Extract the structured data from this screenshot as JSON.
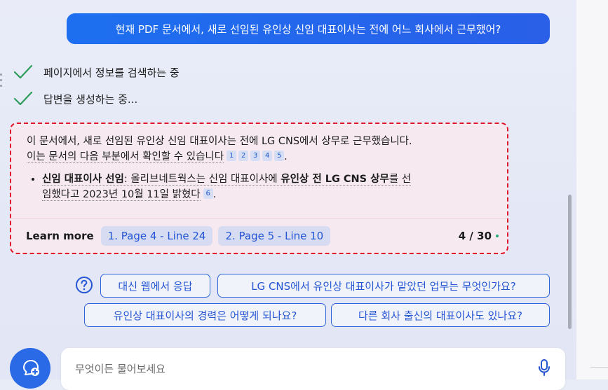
{
  "user_message": "현재 PDF 문서에서, 새로 선임된 유인상 신임 대표이사는 전에 어느 회사에서 근무했어?",
  "progress": [
    {
      "icon": "checkmark-icon",
      "label": "페이지에서 정보를 검색하는 중"
    },
    {
      "icon": "checkmark-icon",
      "label": "답변을 생성하는 중..."
    }
  ],
  "answer": {
    "line1": "이 문서에서, 새로 선임된 유인상 신임 대표이사는 전에 LG CNS에서 상무로 근무했습니다.",
    "line2": "이는 문서의 다음 부분에서 확인할 수 있습니다",
    "line2_citations": [
      "1",
      "2",
      "3",
      "4",
      "5"
    ],
    "bullet": {
      "bold1": "신임 대표이사 선임",
      "text1": ": 올리브네트웍스는 신임 대표이사에 ",
      "bold2": "유인상 전 LG CNS 상무",
      "text2": "를 선",
      "line2": "임했다고 2023년 10월 11일 밝혔다",
      "citation": "6"
    }
  },
  "learn_more": {
    "label": "Learn more",
    "sources": [
      "1. Page 4 - Line 24",
      "2. Page 5 - Line 10"
    ],
    "count": "4 / 30"
  },
  "suggestions": [
    "대신 웹에서 응답",
    "LG CNS에서 유인상 대표이사가 맡았던 업무는 무엇인가요?",
    "유인상 대표이사의 경력은 어떻게 되나요?",
    "다른 회사 출신의 대표이사도 있나요?"
  ],
  "input": {
    "placeholder": "무엇이든 물어보세요"
  },
  "colors": {
    "accent": "#2a6ae6",
    "highlight_border": "#e0152b",
    "check": "#2e9d5b"
  }
}
